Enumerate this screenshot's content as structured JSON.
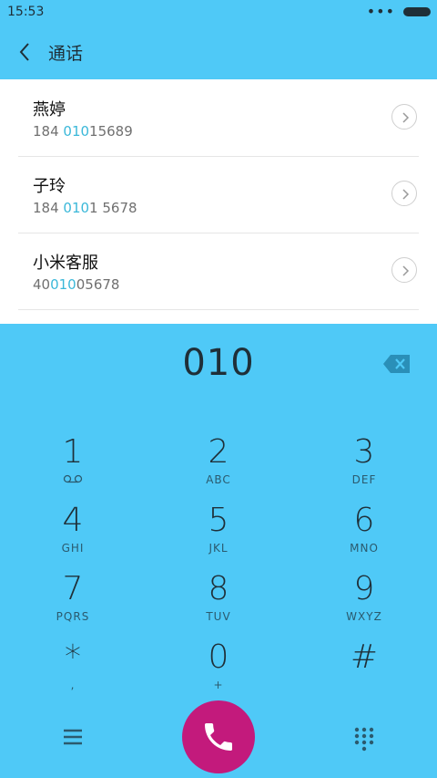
{
  "status": {
    "time": "15:53",
    "dots": "•••"
  },
  "header": {
    "title": "通话"
  },
  "results": [
    {
      "name": "燕婷",
      "num_pre": "184 ",
      "num_hl": "010",
      "num_post": "15689"
    },
    {
      "name": "子玲",
      "num_pre": "184 ",
      "num_hl": "010",
      "num_post": "1 5678"
    },
    {
      "name": "小米客服",
      "num_pre": "40",
      "num_hl": "010",
      "num_post": "05678"
    }
  ],
  "dialer": {
    "entered": "010",
    "keys": [
      {
        "digit": "1",
        "letters": ""
      },
      {
        "digit": "2",
        "letters": "ABC"
      },
      {
        "digit": "3",
        "letters": "DEF"
      },
      {
        "digit": "4",
        "letters": "GHI"
      },
      {
        "digit": "5",
        "letters": "JKL"
      },
      {
        "digit": "6",
        "letters": "MNO"
      },
      {
        "digit": "7",
        "letters": "PQRS"
      },
      {
        "digit": "8",
        "letters": "TUV"
      },
      {
        "digit": "9",
        "letters": "WXYZ"
      },
      {
        "digit": "*",
        "letters": ","
      },
      {
        "digit": "0",
        "letters": "+"
      },
      {
        "digit": "#",
        "letters": ""
      }
    ]
  },
  "colors": {
    "accent": "#4fc9f7",
    "call": "#c31a7c",
    "highlight": "#3bb8d9"
  },
  "icons": [
    "back-icon",
    "chevron-right-icon",
    "backspace-icon",
    "voicemail-icon",
    "menu-icon",
    "phone-icon",
    "dialpad-icon"
  ]
}
